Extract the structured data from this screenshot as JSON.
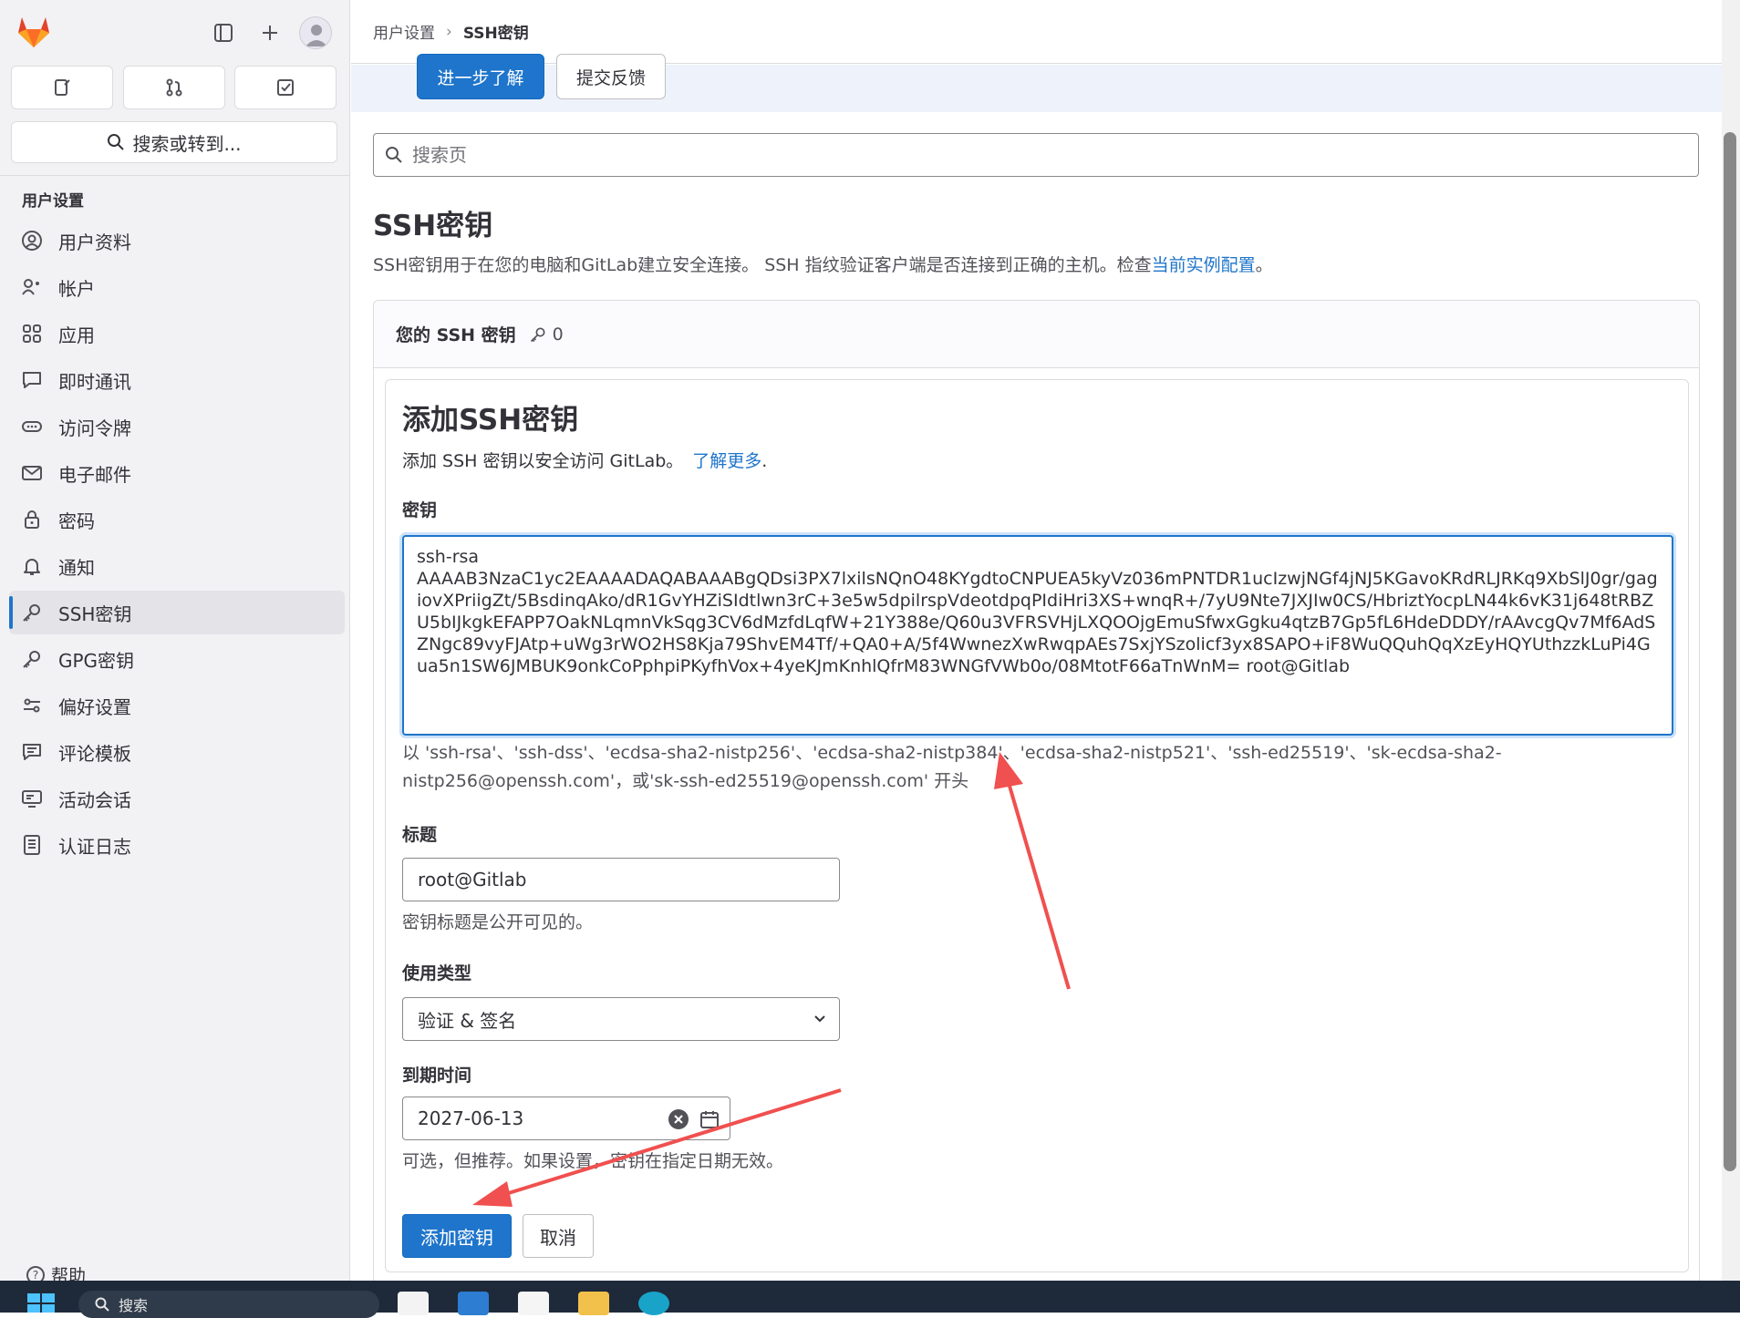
{
  "sidebar": {
    "search_label": "搜索或转到...",
    "section_title": "用户设置",
    "items": [
      {
        "label": "用户资料",
        "icon": "profile-icon"
      },
      {
        "label": "帐户",
        "icon": "account-icon"
      },
      {
        "label": "应用",
        "icon": "applications-icon"
      },
      {
        "label": "即时通讯",
        "icon": "chat-icon"
      },
      {
        "label": "访问令牌",
        "icon": "token-icon"
      },
      {
        "label": "电子邮件",
        "icon": "mail-icon"
      },
      {
        "label": "密码",
        "icon": "lock-icon"
      },
      {
        "label": "通知",
        "icon": "bell-icon"
      },
      {
        "label": "SSH密钥",
        "icon": "key-icon",
        "active": true
      },
      {
        "label": "GPG密钥",
        "icon": "key-icon"
      },
      {
        "label": "偏好设置",
        "icon": "preferences-icon"
      },
      {
        "label": "评论模板",
        "icon": "comment-template-icon"
      },
      {
        "label": "活动会话",
        "icon": "monitor-icon"
      },
      {
        "label": "认证日志",
        "icon": "log-icon"
      }
    ],
    "help_label": "帮助"
  },
  "breadcrumb": {
    "parent": "用户设置",
    "current": "SSH密钥"
  },
  "banner": {
    "learn_more_label": "进一步了解",
    "feedback_label": "提交反馈"
  },
  "page_search": {
    "placeholder": "搜索页"
  },
  "page": {
    "title": "SSH密钥",
    "description": "SSH密钥用于在您的电脑和GitLab建立安全连接。 SSH 指纹验证客户端是否连接到正确的主机。检查",
    "description_link": "当前实例配置",
    "description_end": "。"
  },
  "keys_card": {
    "title": "您的 SSH 密钥",
    "count": "0"
  },
  "add_form": {
    "title": "添加SSH密钥",
    "subtitle": "添加 SSH 密钥以安全访问 GitLab。",
    "subtitle_link": "了解更多",
    "subtitle_end": ".",
    "key_label": "密钥",
    "key_value": "ssh-rsa\nAAAAB3NzaC1yc2EAAAADAQABAAABgQDsi3PX7lxilsNQnO48KYgdtoCNPUEA5kyVz036mPNTDR1ucIzwjNGf4jNJ5KGavoKRdRLJRKq9XbSlJ0gr/gagiovXPriigZt/5BsdinqAko/dR1GvYHZiSIdtlwn3rC+3e5w5dpilrspVdeotdpqPIdiHri3XS+wnqR+/7yU9Nte7JXJIw0CS/HbriztYocpLN44k6vK31j648tRBZU5bIJkgkEFAPP7OakNLqmnVkSqg3CV6dMzfdLqfW+21Y388e/Q60u3VFRSVHjLXQOOjgEmuSfwxGgku4qtzB7Gp5fL6HdeDDDY/rAAvcgQv7Mf6AdSZNgc89vyFJAtp+uWg3rWO2HS8Kja79ShvEM4Tf/+QA0+A/5f4WwnezXwRwqpAEs7SxjYSzolicf3yx8SAPO+iF8WuQQuhQqXzEyHQYUthzzkLuPi4Gua5n1SW6JMBUK9onkCoPphpiPKyfhVox+4yeKJmKnhlQfrM83WNGfVWb0o/08MtotF66aTnWnM= root@Gitlab",
    "key_help": "以 'ssh-rsa'、'ssh-dss'、'ecdsa-sha2-nistp256'、'ecdsa-sha2-nistp384'、'ecdsa-sha2-nistp521'、'ssh-ed25519'、'sk-ecdsa-sha2-nistp256@openssh.com'，或'sk-ssh-ed25519@openssh.com' 开头",
    "title_label": "标题",
    "title_value": "root@Gitlab",
    "title_help": "密钥标题是公开可见的。",
    "usage_label": "使用类型",
    "usage_value": "验证 & 签名",
    "expires_label": "到期时间",
    "expires_value": "2027-06-13",
    "expires_help": "可选，但推荐。如果设置，密钥在指定日期无效。",
    "submit_label": "添加密钥",
    "cancel_label": "取消"
  },
  "taskbar": {
    "search_label": "搜索"
  },
  "colors": {
    "accent": "#1f75cb",
    "annotation_arrow": "#f0504f"
  }
}
